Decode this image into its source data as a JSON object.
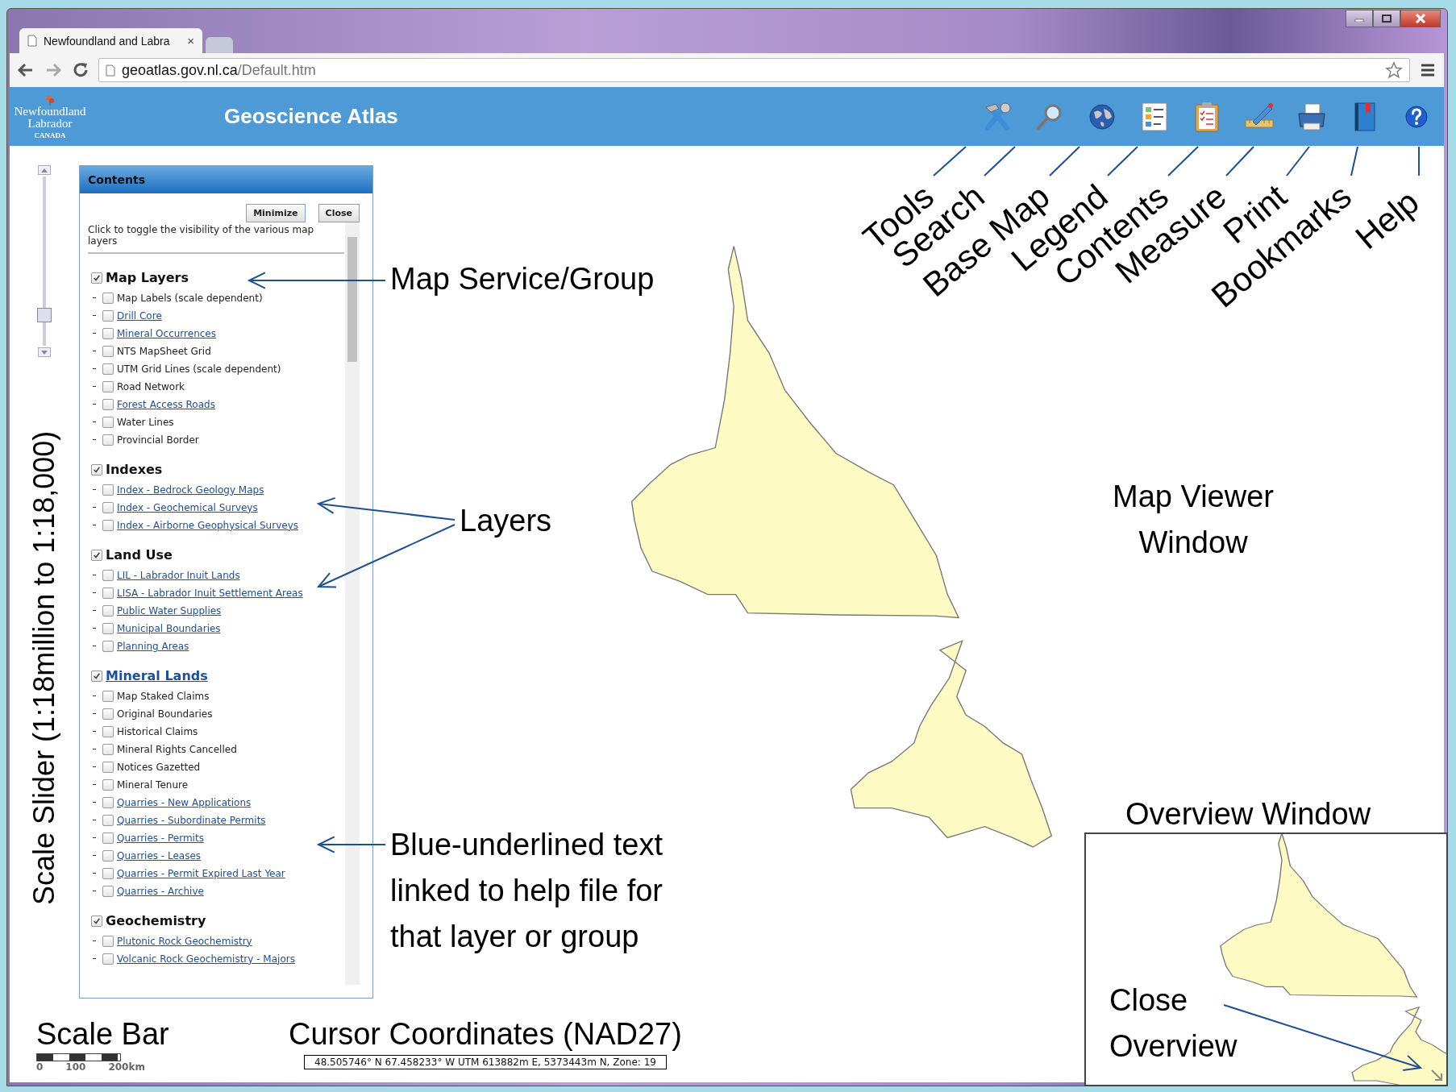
{
  "browser": {
    "tabs": [
      {
        "title": "Newfoundland and Labra",
        "close": "×",
        "selected": true
      },
      {
        "selected": false
      }
    ],
    "address": {
      "host": "geoatlas.gov.nl.ca",
      "path": "/Default.htm"
    }
  },
  "header": {
    "logo": {
      "line1": "Newfoundland",
      "line2": "Labrador",
      "line3": "CANADA"
    },
    "title": "Geoscience Atlas",
    "tools": [
      {
        "kind": "tools",
        "label": "Tools"
      },
      {
        "kind": "search",
        "label": "Search"
      },
      {
        "kind": "basemap",
        "label": "Base Map"
      },
      {
        "kind": "legend",
        "label": "Legend"
      },
      {
        "kind": "contents",
        "label": "Contents"
      },
      {
        "kind": "measure",
        "label": "Measure"
      },
      {
        "kind": "print",
        "label": "Print"
      },
      {
        "kind": "bookmarks",
        "label": "Bookmarks"
      },
      {
        "kind": "help",
        "label": "Help"
      }
    ]
  },
  "slider": {
    "level": 0.15,
    "caption": "Scale Slider (1:18million to 1:18,000)"
  },
  "contents": {
    "title": "Contents",
    "buttons": [
      "Minimize",
      "Close"
    ],
    "intro": "Click to toggle the visibility of the various map layers",
    "groups": [
      {
        "label": "Map Layers",
        "checked": true,
        "link": false,
        "layers": [
          {
            "label": "Map Labels (scale dependent)",
            "checked": false,
            "link": false
          },
          {
            "label": "Drill Core",
            "checked": false,
            "link": true
          },
          {
            "label": "Mineral Occurrences",
            "checked": false,
            "link": true
          },
          {
            "label": "NTS MapSheet Grid",
            "checked": false,
            "link": false
          },
          {
            "label": "UTM Grid Lines (scale dependent)",
            "checked": false,
            "link": false
          },
          {
            "label": "Road Network",
            "checked": false,
            "link": false
          },
          {
            "label": "Forest Access Roads",
            "checked": false,
            "link": true
          },
          {
            "label": "Water Lines",
            "checked": false,
            "link": false
          },
          {
            "label": "Provincial Border",
            "checked": false,
            "link": false
          }
        ]
      },
      {
        "label": "Indexes",
        "checked": true,
        "link": false,
        "layers": [
          {
            "label": "Index - Bedrock Geology Maps",
            "checked": false,
            "link": true
          },
          {
            "label": "Index - Geochemical Surveys",
            "checked": false,
            "link": true
          },
          {
            "label": "Index - Airborne Geophysical Surveys",
            "checked": false,
            "link": true
          }
        ]
      },
      {
        "label": "Land Use",
        "checked": true,
        "link": false,
        "layers": [
          {
            "label": "LIL - Labrador Inuit Lands",
            "checked": false,
            "link": true
          },
          {
            "label": "LISA - Labrador Inuit Settlement Areas",
            "checked": false,
            "link": true
          },
          {
            "label": "Public Water Supplies",
            "checked": false,
            "link": true
          },
          {
            "label": "Municipal Boundaries",
            "checked": false,
            "link": true
          },
          {
            "label": "Planning Areas",
            "checked": false,
            "link": true
          }
        ]
      },
      {
        "label": "Mineral Lands",
        "checked": true,
        "link": true,
        "layers": [
          {
            "label": "Map Staked Claims",
            "checked": false,
            "link": false
          },
          {
            "label": "Original Boundaries",
            "checked": false,
            "link": false
          },
          {
            "label": "Historical Claims",
            "checked": false,
            "link": false
          },
          {
            "label": "Mineral Rights Cancelled",
            "checked": false,
            "link": false
          },
          {
            "label": "Notices Gazetted",
            "checked": false,
            "link": false
          },
          {
            "label": "Mineral Tenure",
            "checked": false,
            "link": false
          },
          {
            "label": "Quarries - New Applications",
            "checked": false,
            "link": true
          },
          {
            "label": "Quarries - Subordinate Permits",
            "checked": false,
            "link": true
          },
          {
            "label": "Quarries - Permits",
            "checked": false,
            "link": true
          },
          {
            "label": "Quarries - Leases",
            "checked": false,
            "link": true
          },
          {
            "label": "Quarries - Permit Expired Last Year",
            "checked": false,
            "link": true
          },
          {
            "label": "Quarries - Archive",
            "checked": false,
            "link": true
          }
        ]
      },
      {
        "label": "Geochemistry",
        "checked": true,
        "link": false,
        "layers": [
          {
            "label": "Plutonic Rock Geochemistry",
            "checked": false,
            "link": true
          },
          {
            "label": "Volcanic Rock Geochemistry - Majors",
            "checked": false,
            "link": true
          }
        ]
      }
    ]
  },
  "callouts": [
    {
      "text": "Map Service/Group"
    },
    {
      "text": "Layers"
    },
    {
      "text": "Blue-underlined text linked to help file for that layer or group"
    }
  ],
  "map_caption": "Map Viewer Window",
  "overview": {
    "caption": "Overview Window",
    "close_caption": "Close Overview"
  },
  "scale_bar": {
    "caption": "Scale Bar",
    "ticks": [
      "0",
      "100",
      "200km"
    ]
  },
  "coordinates": {
    "caption": "Cursor Coordinates (NAD27)",
    "value": "48.505746° N 67.458233° W UTM 613882m E, 5373443m N, Zone: 19"
  }
}
